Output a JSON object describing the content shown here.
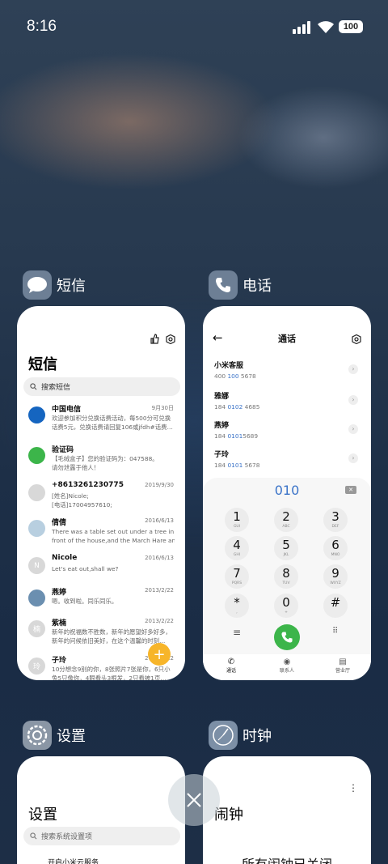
{
  "status": {
    "time": "8:16",
    "battery": "100"
  },
  "apps": {
    "sms": {
      "name": "短信",
      "title": "短信",
      "search_placeholder": "搜索短信",
      "messages": [
        {
          "name": "中国电信",
          "date": "9月30日",
          "preview1": "欢迎参加积分兑换话费活动，每500分可兑换",
          "preview2": "话费5元，兑换话费请回复106或jfdh#话费…",
          "avatar_color": "#1565c0",
          "avatar_text": ""
        },
        {
          "name": "验证码",
          "date": "",
          "preview1": "【毛绒盒子】您的验证码为：047588。",
          "preview2": "请勿泄露于他人！",
          "avatar_color": "#3cb54a",
          "avatar_text": ""
        },
        {
          "name": "+8613261230775",
          "date": "2019/9/30",
          "preview1": "[姓名]Nicole;",
          "preview2": "[电话]17004957610;",
          "avatar_color": "#d8d8d8",
          "avatar_text": ""
        },
        {
          "name": "倩倩",
          "date": "2016/6/13",
          "preview1": "There was a table set out under a tree in",
          "preview2": "front of the house,and the March Hare an…",
          "avatar_color": "#b8cfe0",
          "avatar_text": ""
        },
        {
          "name": "Nicole",
          "date": "2016/6/13",
          "preview1": "Let's eat out,shall we?",
          "preview2": "",
          "avatar_color": "#d8d8d8",
          "avatar_text": "N"
        },
        {
          "name": "燕婷",
          "date": "2013/2/22",
          "preview1": "嗯。收到啦。同乐同乐。",
          "preview2": "",
          "avatar_color": "#6b8fb0",
          "avatar_text": ""
        },
        {
          "name": "紫楠",
          "date": "2013/2/22",
          "preview1": "新年的祝福数不胜数，新年的愿望好多好多，",
          "preview2": "新年的问候依旧美好，在这个温馨的时刻…",
          "avatar_color": "#d8d8d8",
          "avatar_text": "楠"
        },
        {
          "name": "子玲",
          "date": "2013/2/22",
          "preview1": "10分想念9别的你，8张照片7张是你，6只小",
          "preview2": "兔5只像你，4眼看头3根发，2只看被1页…",
          "avatar_color": "#d8d8d8",
          "avatar_text": "玲"
        }
      ]
    },
    "phone": {
      "name": "电话",
      "title": "通话",
      "typed": "010",
      "contacts": [
        {
          "name": "小米客服",
          "pre": "400 ",
          "hl": "100",
          "post": " 5678"
        },
        {
          "name": "雅娜",
          "pre": "184 ",
          "hl": "0102",
          "post": " 4685"
        },
        {
          "name": "燕婷",
          "pre": "184 ",
          "hl": "0101",
          "post": "5689"
        },
        {
          "name": "子玲",
          "pre": "184 ",
          "hl": "0101",
          "post": " 5678"
        }
      ],
      "keys": [
        {
          "d": "1",
          "l": "GUI"
        },
        {
          "d": "2",
          "l": "ABC"
        },
        {
          "d": "3",
          "l": "DEF"
        },
        {
          "d": "4",
          "l": "GHI"
        },
        {
          "d": "5",
          "l": "JKL"
        },
        {
          "d": "6",
          "l": "MNO"
        },
        {
          "d": "7",
          "l": "PQRS"
        },
        {
          "d": "8",
          "l": "TUV"
        },
        {
          "d": "9",
          "l": "WXYZ"
        },
        {
          "d": "*",
          "l": ","
        },
        {
          "d": "0",
          "l": "+"
        },
        {
          "d": "#",
          "l": ""
        }
      ],
      "tabs": {
        "calls": "通话",
        "contacts": "联系人",
        "service": "营业厅"
      }
    },
    "settings": {
      "name": "设置",
      "title": "设置",
      "search_placeholder": "搜索系统设置项",
      "first_item": "开启小米云服务"
    },
    "clock": {
      "name": "时钟",
      "title": "闹钟",
      "message": "所有闹钟已关闭"
    }
  },
  "colors": {
    "accent_blue": "#3a73c8",
    "call_green": "#3cb54a",
    "fab_orange": "#f7b52a"
  }
}
